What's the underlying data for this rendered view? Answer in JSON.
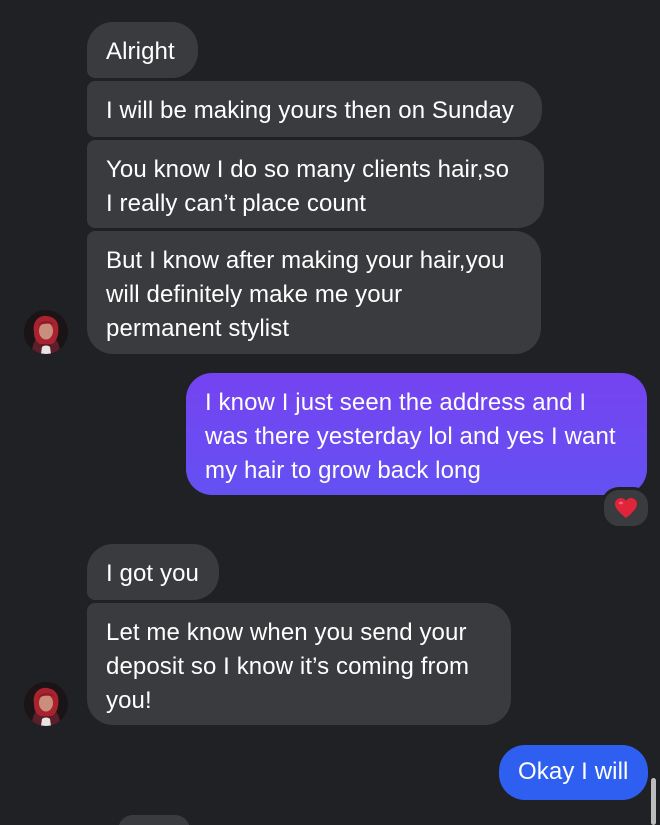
{
  "conversation": {
    "messages": [
      {
        "id": "m1",
        "direction": "incoming",
        "text": "Alright"
      },
      {
        "id": "m2",
        "direction": "incoming",
        "text": "I will be making yours then on Sunday"
      },
      {
        "id": "m3",
        "direction": "incoming",
        "text": "You know I do so many clients hair,so\nI really can’t place count"
      },
      {
        "id": "m4",
        "direction": "incoming",
        "text": "But I know after making your hair,you\nwill definitely make me your\npermanent stylist"
      },
      {
        "id": "m5",
        "direction": "outgoing",
        "text": "I know I just seen the address and I\nwas there yesterday lol and yes I want\nmy hair to grow back long",
        "reaction": "heart"
      },
      {
        "id": "m6",
        "direction": "incoming",
        "text": "I got you"
      },
      {
        "id": "m7",
        "direction": "incoming",
        "text": "Let me know when you send your\ndeposit so I know it’s coming from\nyou!"
      },
      {
        "id": "m8",
        "direction": "outgoing",
        "text": "Okay I will"
      }
    ]
  },
  "colors": {
    "background": "#202124",
    "incoming_bubble": "#3a3b3e",
    "outgoing_gradient_start": "#7a45f2",
    "outgoing_gradient_end": "#2f63f0",
    "reaction_heart": "#e0243a"
  }
}
